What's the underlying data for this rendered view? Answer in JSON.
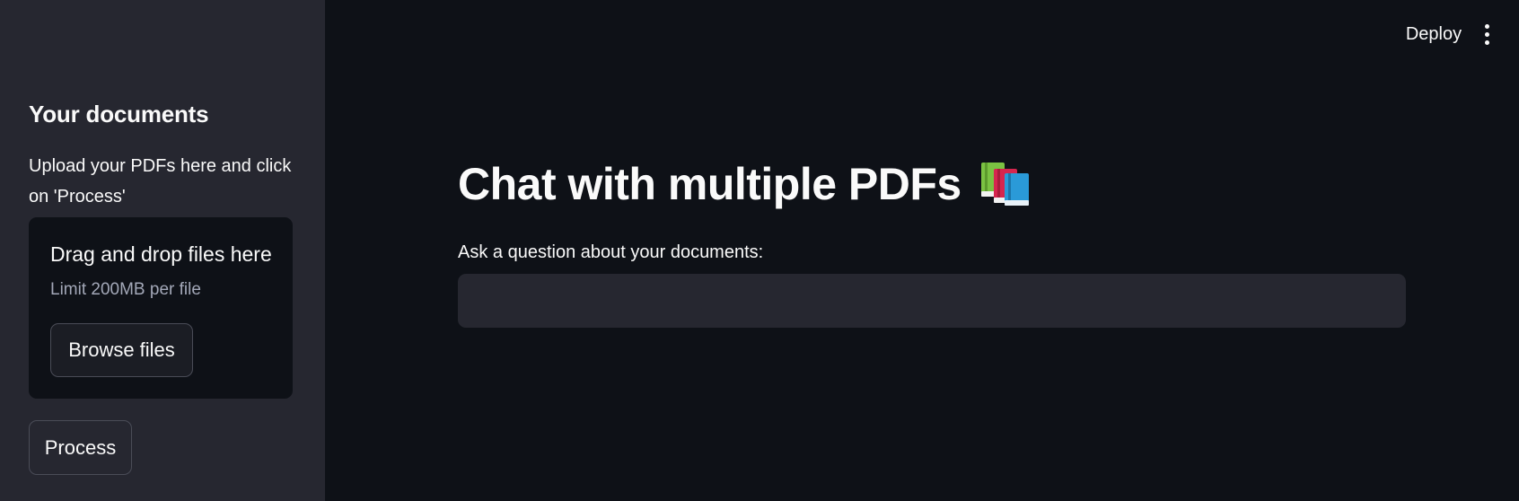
{
  "header": {
    "deploy_label": "Deploy",
    "menu_icon": "kebab-menu-icon"
  },
  "sidebar": {
    "title": "Your documents",
    "description": "Upload your PDFs here and click on 'Process'",
    "uploader": {
      "title": "Drag and drop files here",
      "limit": "Limit 200MB per file",
      "browse_label": "Browse files"
    },
    "process_label": "Process"
  },
  "main": {
    "title": "Chat with multiple PDFs",
    "title_icon": "books-icon",
    "question_label": "Ask a question about your documents:",
    "question_value": ""
  },
  "colors": {
    "background": "#0e1117",
    "sidebar": "#262730",
    "text": "#fafafa",
    "muted_text": "#a3a8b8"
  }
}
